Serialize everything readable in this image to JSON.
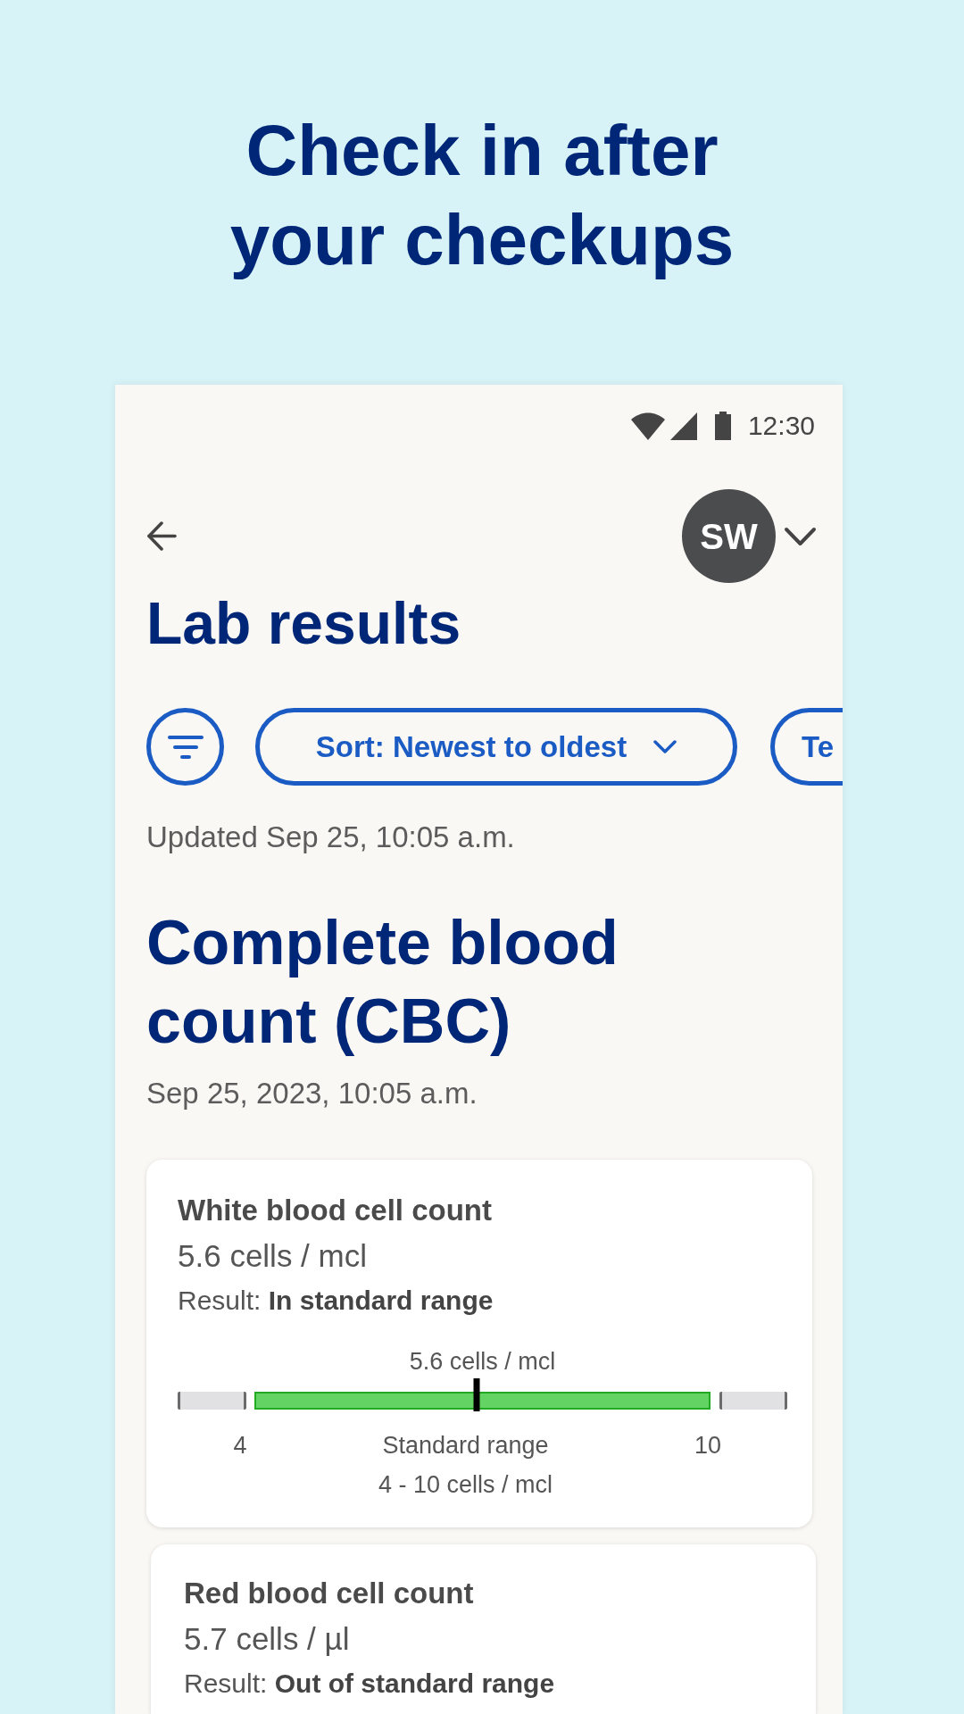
{
  "headline": "Check in after your checkups",
  "status_bar": {
    "time": "12:30"
  },
  "header": {
    "avatar_initials": "SW"
  },
  "title": "Lab results",
  "chips": [
    {
      "label": "Sort: Newest to oldest",
      "kind": "dropdown"
    },
    {
      "label": "Te",
      "kind": "chip"
    }
  ],
  "updated": "Updated Sep 25, 10:05 a.m.",
  "panel": {
    "title": "Complete blood count (CBC)",
    "date": "Sep 25, 2023, 10:05 a.m.",
    "results": [
      {
        "name": "White blood cell count",
        "value": "5.6 cells / mcl",
        "result": "Result: **In standard range**",
        "in_range": true,
        "range": {
          "reading": "5.6 cells / mcl",
          "level": 0.49,
          "low": "4",
          "label": "Standard range",
          "high": "10",
          "span": "4 - 10 cells / mcl"
        }
      },
      {
        "name": "Red blood cell count",
        "value": "5.7 cells / µl",
        "result": "Result: **Out of standard range**"
      }
    ]
  }
}
